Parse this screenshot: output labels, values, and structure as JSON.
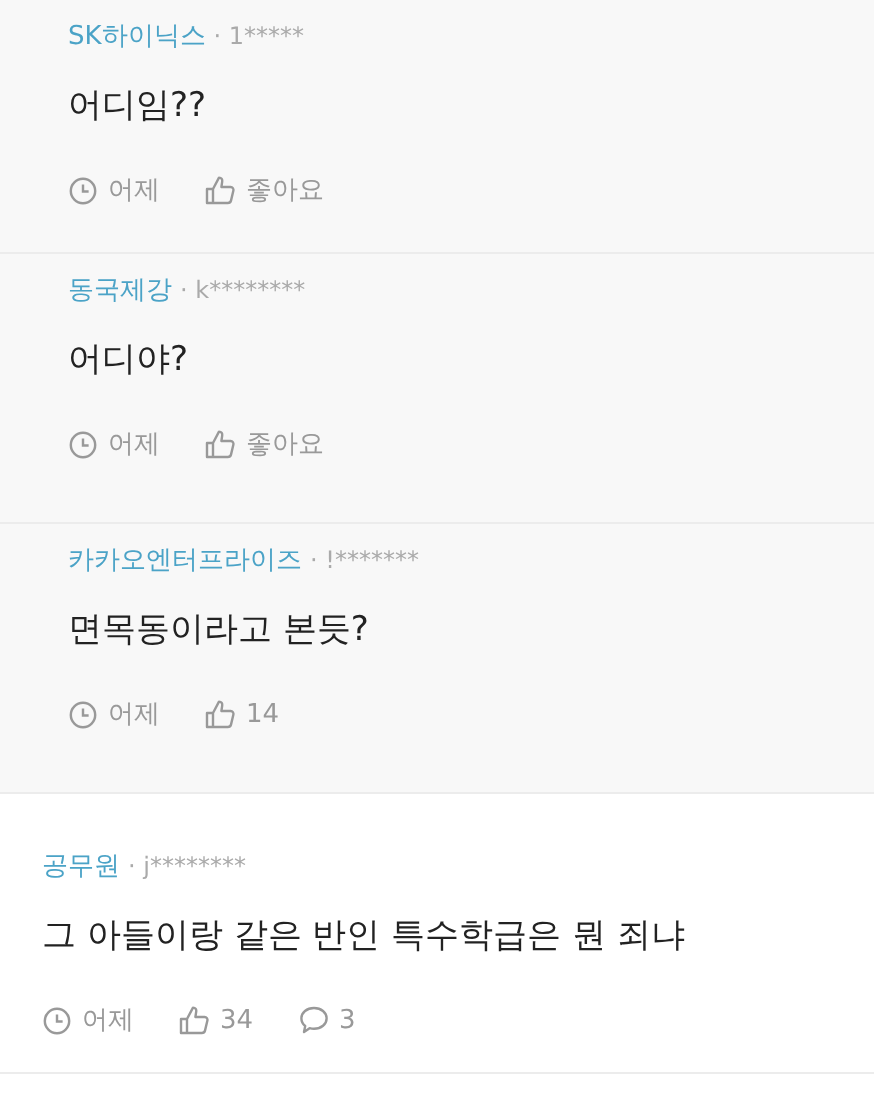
{
  "comments": [
    {
      "kind": "reply",
      "author": "SK하이닉스",
      "user_id": "· 1*****",
      "text": "어디임??",
      "time": "어제",
      "likes": "좋아요"
    },
    {
      "kind": "reply",
      "author": "동국제강",
      "user_id": "· k********",
      "text": "어디야?",
      "time": "어제",
      "likes": "좋아요"
    },
    {
      "kind": "reply",
      "author": "카카오엔터프라이즈",
      "user_id": "· !*******",
      "text": "면목동이라고 본듯?",
      "time": "어제",
      "likes": "14"
    },
    {
      "kind": "comment",
      "author": "공무원",
      "user_id": "· j********",
      "text": "그 아들이랑 같은 반인 특수학급은 뭔 죄냐",
      "time": "어제",
      "likes": "34",
      "replies": "3"
    }
  ]
}
